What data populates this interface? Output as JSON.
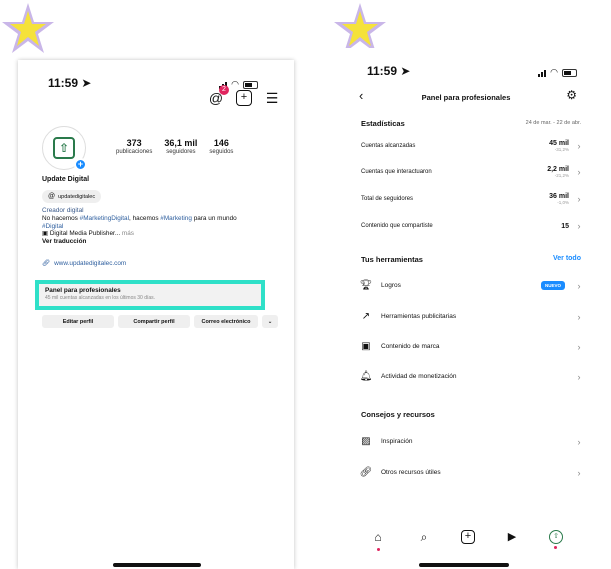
{
  "left": {
    "status_time": "11:59 ➤",
    "threads_badge": "2",
    "stats": [
      {
        "value": "373",
        "label": "publicaciones"
      },
      {
        "value": "36,1 mil",
        "label": "seguidores"
      },
      {
        "value": "146",
        "label": "seguidos"
      }
    ],
    "profile_name": "Update Digital",
    "threads_handle": "updatedigitalec",
    "bio": {
      "category": "Creador digital",
      "line1_a": "No hacemos ",
      "line1_tag1": "#MarketingDigital",
      "line1_b": ", hacemos ",
      "line1_tag2": "#Marketing",
      "line1_c": " para un mundo",
      "line2_tag": "#Digital",
      "line3": "▣ Digital Media Publisher...",
      "more": " más",
      "translate": "Ver traducción"
    },
    "link": "www.updatedigitalec.com",
    "panel": {
      "title": "Panel para profesionales",
      "subtitle": "45 mil cuentas alcanzadas en los últimos 30 días."
    },
    "buttons": {
      "edit": "Editar perfil",
      "share": "Compartir perfil",
      "email": "Correo electrónico"
    }
  },
  "right": {
    "status_time": "11:59 ➤",
    "title": "Panel para profesionales",
    "stats_header": "Estadísticas",
    "date_range": "24 de mar. - 22 de abr.",
    "stats": [
      {
        "label": "Cuentas alcanzadas",
        "value": "45 mil",
        "delta": "-31,2%"
      },
      {
        "label": "Cuentas que interactuaron",
        "value": "2,2 mil",
        "delta": "-21,2%"
      },
      {
        "label": "Total de seguidores",
        "value": "36 mil",
        "delta": "-1,0%"
      },
      {
        "label": "Contenido que compartiste",
        "value": "15",
        "delta": ""
      }
    ],
    "tools_header": "Tus herramientas",
    "see_all": "Ver todo",
    "new_badge": "NUEVO",
    "tools": [
      {
        "label": "Logros",
        "icon": "trophy-icon"
      },
      {
        "label": "Herramientas publicitarias",
        "icon": "trend-arrow-icon"
      },
      {
        "label": "Contenido de marca",
        "icon": "branded-content-icon"
      },
      {
        "label": "Actividad de monetización",
        "icon": "bell-icon"
      }
    ],
    "tips_header": "Consejos y recursos",
    "tips": [
      {
        "label": "Inspiración",
        "icon": "image-icon"
      },
      {
        "label": "Otros recursos útiles",
        "icon": "link-icon"
      }
    ]
  },
  "colors": {
    "accent": "#1a8cff",
    "highlight": "#2fe0c8",
    "star": "#f5e23a",
    "star_outline": "#c9b6e8",
    "notification": "#e0245e"
  }
}
